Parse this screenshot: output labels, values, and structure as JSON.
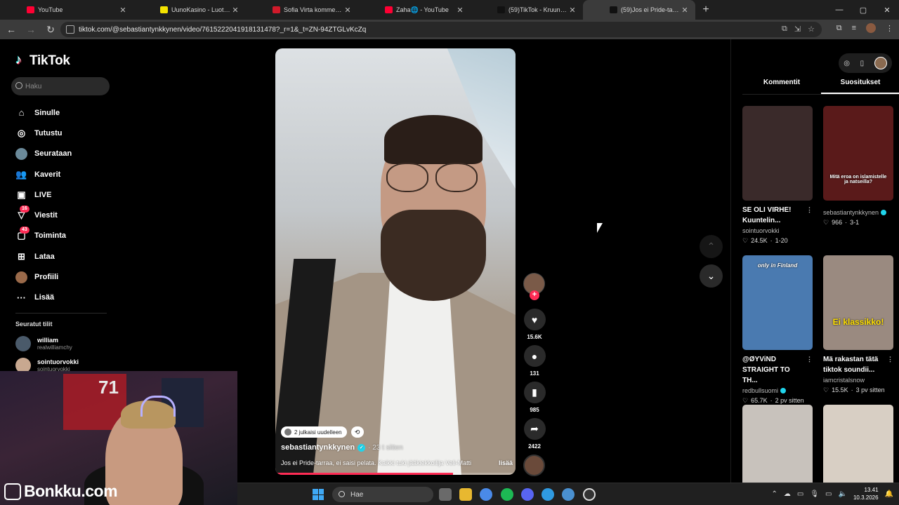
{
  "browser": {
    "tabs": [
      {
        "title": "YouTube",
        "color": "#ff0033"
      },
      {
        "title": "UunoKasino - Luotettava sekä",
        "color": "#f5e400"
      },
      {
        "title": "Sofia Virta kommentoi TPS-erot",
        "color": "#d11a2a"
      },
      {
        "title": "Zaha🌐 - YouTube",
        "color": "#ff0033"
      },
      {
        "title": "(59)TikTok - Kruunaa päiväsi",
        "color": "#111111"
      },
      {
        "title": "(59)Jos ei Pride-tarraa, ei sa",
        "color": "#111111",
        "active": true
      }
    ],
    "url": "tiktok.com/@sebastiantynkkynen/video/7615222041918131478?_r=1&_t=ZN-94ZTGLvKcZq"
  },
  "sidebar": {
    "logo": "TikTok",
    "search_placeholder": "Haku",
    "nav": [
      {
        "label": "Sinulle",
        "icon": "home-icon",
        "glyph": "⌂"
      },
      {
        "label": "Tutustu",
        "icon": "compass-icon",
        "glyph": "◎"
      },
      {
        "label": "Seurataan",
        "icon": "following-avatar",
        "glyph": ""
      },
      {
        "label": "Kaverit",
        "icon": "friends-icon",
        "glyph": "👥"
      },
      {
        "label": "LIVE",
        "icon": "live-icon",
        "glyph": "▣"
      },
      {
        "label": "Viestit",
        "icon": "messages-icon",
        "glyph": "▽",
        "badge": "16"
      },
      {
        "label": "Toiminta",
        "icon": "activity-icon",
        "glyph": "▢",
        "badge": "43"
      },
      {
        "label": "Lataa",
        "icon": "upload-icon",
        "glyph": "⊞"
      },
      {
        "label": "Profiili",
        "icon": "profile-avatar",
        "glyph": ""
      },
      {
        "label": "Lisää",
        "icon": "more-icon",
        "glyph": "···"
      }
    ],
    "following_title": "Seuratut tilit",
    "following": [
      {
        "name": "william",
        "handle": "realwilliamchy"
      },
      {
        "name": "sointuorvokki",
        "handle": "sointuorvokki"
      }
    ]
  },
  "webcam": {
    "brand": "Bonkku.com",
    "jersey_number": "71"
  },
  "video": {
    "repost_label": "2 julkaisi uudelleen",
    "author": "sebastiantynkkynen",
    "time": "· 23 t sitten",
    "caption": "Jos ei Pride-tarraa, ei saisi pelata. Kaikki tuki jääkiekkoilija Veli-Matti",
    "more": "lisää",
    "progress": 0.74
  },
  "actions": {
    "likes": "15.6K",
    "comments": "131",
    "saves": "985",
    "shares": "2422"
  },
  "right_panel": {
    "tabs": [
      "Kommentit",
      "Suositukset"
    ],
    "active_tab": "Suositukset",
    "cards": [
      {
        "title": "SE OLI VIRHE! Kuuntelin...",
        "author": "sointuorvokki",
        "likes": "24.5K",
        "date": "1-20",
        "overlay": "",
        "bg": "#3a2a2a",
        "verified": false
      },
      {
        "title": "",
        "author": "sebastiantynkkynen",
        "likes": "966",
        "date": "3-1",
        "overlay": "Mitä eroa on islamistelle ja natseilla?",
        "bg": "#5a1a1a",
        "verified": true
      },
      {
        "title": "@ØYViND STRAIGHT TO TH...",
        "author": "redbullsuomi",
        "likes": "65.7K",
        "date": "2 pv sitten",
        "overlay": "only in Finland",
        "bg": "#4a7ab0",
        "verified": true
      },
      {
        "title": "Mä rakastan tätä tiktok soundii...",
        "author": "iamcristalsnow",
        "likes": "15.5K",
        "date": "3 pv sitten",
        "overlay": "Ei klassikko!",
        "bg": "#9a8a80",
        "verified": false
      },
      {
        "title": "",
        "author": "",
        "likes": "",
        "date": "",
        "overlay": "",
        "bg": "#c8c2bc",
        "verified": false
      },
      {
        "title": "",
        "author": "",
        "likes": "",
        "date": "",
        "overlay": "",
        "bg": "#d8cfc4",
        "verified": false
      }
    ]
  },
  "taskbar": {
    "search_placeholder": "Hae",
    "time": "13.41",
    "date": "10.3.2026"
  }
}
